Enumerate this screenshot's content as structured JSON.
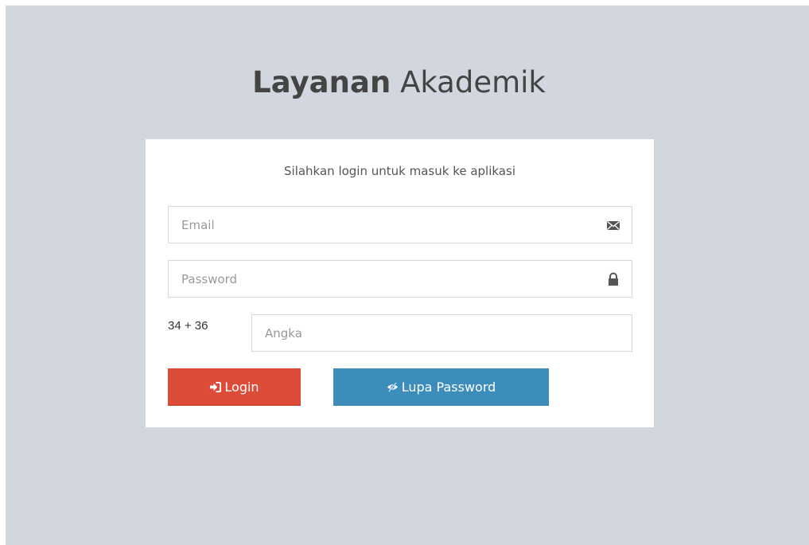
{
  "header": {
    "title_bold": "Layanan",
    "title_light": "Akademik"
  },
  "login": {
    "message": "Silahkan login untuk masuk ke aplikasi",
    "email_placeholder": "Email",
    "password_placeholder": "Password",
    "captcha_question": "34 + 36",
    "captcha_placeholder": "Angka",
    "login_label": "Login",
    "forgot_label": "Lupa Password"
  },
  "colors": {
    "background": "#d2d6de",
    "login_button": "#dd4b39",
    "forgot_button": "#3c8dbc"
  },
  "icons": {
    "email": "envelope-icon",
    "password": "lock-icon",
    "login": "sign-in-icon",
    "forgot": "eye-slash-icon"
  }
}
